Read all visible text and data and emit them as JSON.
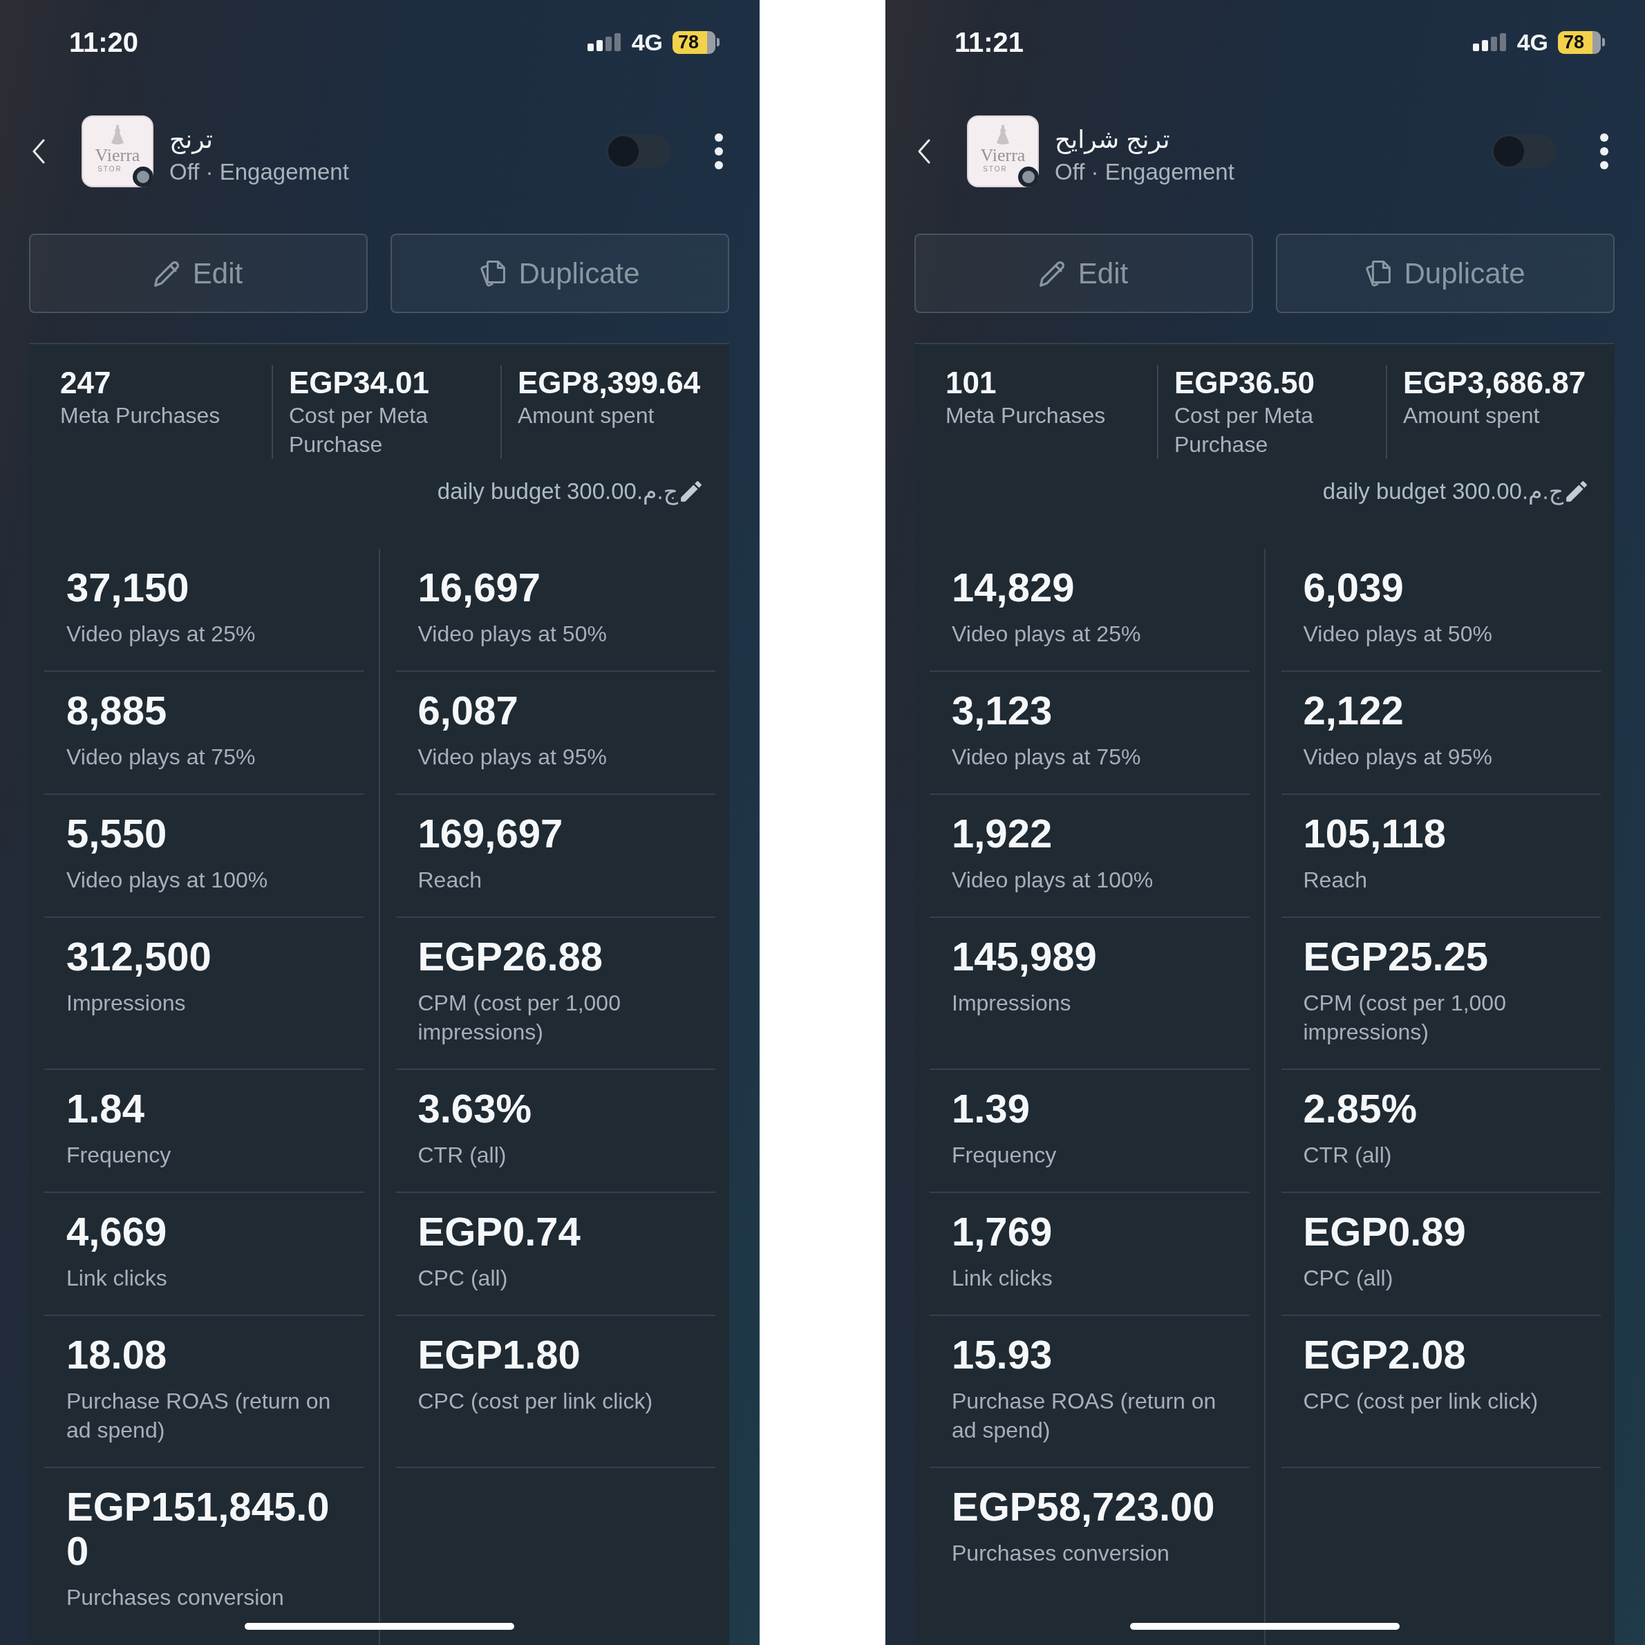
{
  "phones": [
    {
      "status_bar": {
        "time": "11:20",
        "network": "4G",
        "battery": "78"
      },
      "campaign": {
        "name": "ترنج",
        "subtitle": "Off · Engagement",
        "on": false,
        "logo": {
          "name": "Vierra",
          "tagline": "STOR"
        }
      },
      "actions": [
        {
          "kind": "edit",
          "label": "Edit"
        },
        {
          "kind": "duplicate",
          "label": "Duplicate"
        }
      ],
      "summary": [
        {
          "value": "247",
          "label": "Meta Purchases"
        },
        {
          "value": "EGP34.01",
          "label": "Cost per Meta Purchase"
        },
        {
          "value": "EGP8,399.64",
          "label": "Amount spent"
        }
      ],
      "daily_budget": "daily budget 300.00ج.م.‏",
      "metrics": [
        {
          "value": "37,150",
          "label": "Video plays at 25%"
        },
        {
          "value": "16,697",
          "label": "Video plays at 50%"
        },
        {
          "value": "8,885",
          "label": "Video plays at 75%"
        },
        {
          "value": "6,087",
          "label": "Video plays at 95%"
        },
        {
          "value": "5,550",
          "label": "Video plays at 100%"
        },
        {
          "value": "169,697",
          "label": "Reach"
        },
        {
          "value": "312,500",
          "label": "Impressions"
        },
        {
          "value": "EGP26.88",
          "label": "CPM (cost per 1,000 impressions)"
        },
        {
          "value": "1.84",
          "label": "Frequency"
        },
        {
          "value": "3.63%",
          "label": "CTR (all)"
        },
        {
          "value": "4,669",
          "label": "Link clicks"
        },
        {
          "value": "EGP0.74",
          "label": "CPC (all)"
        },
        {
          "value": "18.08",
          "label": "Purchase ROAS (return on ad spend)"
        },
        {
          "value": "EGP1.80",
          "label": "CPC (cost per link click)"
        },
        {
          "value": "EGP151,845.00",
          "label": "Purchases conversion"
        }
      ]
    },
    {
      "status_bar": {
        "time": "11:21",
        "network": "4G",
        "battery": "78"
      },
      "campaign": {
        "name": "ترنج شرايح",
        "subtitle": "Off · Engagement",
        "on": false,
        "logo": {
          "name": "Vierra",
          "tagline": "STOR"
        }
      },
      "actions": [
        {
          "kind": "edit",
          "label": "Edit"
        },
        {
          "kind": "duplicate",
          "label": "Duplicate"
        }
      ],
      "summary": [
        {
          "value": "101",
          "label": "Meta Purchases"
        },
        {
          "value": "EGP36.50",
          "label": "Cost per Meta Purchase"
        },
        {
          "value": "EGP3,686.87",
          "label": "Amount spent"
        }
      ],
      "daily_budget": "daily budget 300.00ج.م.‏",
      "metrics": [
        {
          "value": "14,829",
          "label": "Video plays at 25%"
        },
        {
          "value": "6,039",
          "label": "Video plays at 50%"
        },
        {
          "value": "3,123",
          "label": "Video plays at 75%"
        },
        {
          "value": "2,122",
          "label": "Video plays at 95%"
        },
        {
          "value": "1,922",
          "label": "Video plays at 100%"
        },
        {
          "value": "105,118",
          "label": "Reach"
        },
        {
          "value": "145,989",
          "label": "Impressions"
        },
        {
          "value": "EGP25.25",
          "label": "CPM (cost per 1,000 impressions)"
        },
        {
          "value": "1.39",
          "label": "Frequency"
        },
        {
          "value": "2.85%",
          "label": "CTR (all)"
        },
        {
          "value": "1,769",
          "label": "Link clicks"
        },
        {
          "value": "EGP0.89",
          "label": "CPC (all)"
        },
        {
          "value": "15.93",
          "label": "Purchase ROAS (return on ad spend)"
        },
        {
          "value": "EGP2.08",
          "label": "CPC (cost per link click)"
        },
        {
          "value": "EGP58,723.00",
          "label": "Purchases conversion"
        }
      ]
    }
  ]
}
